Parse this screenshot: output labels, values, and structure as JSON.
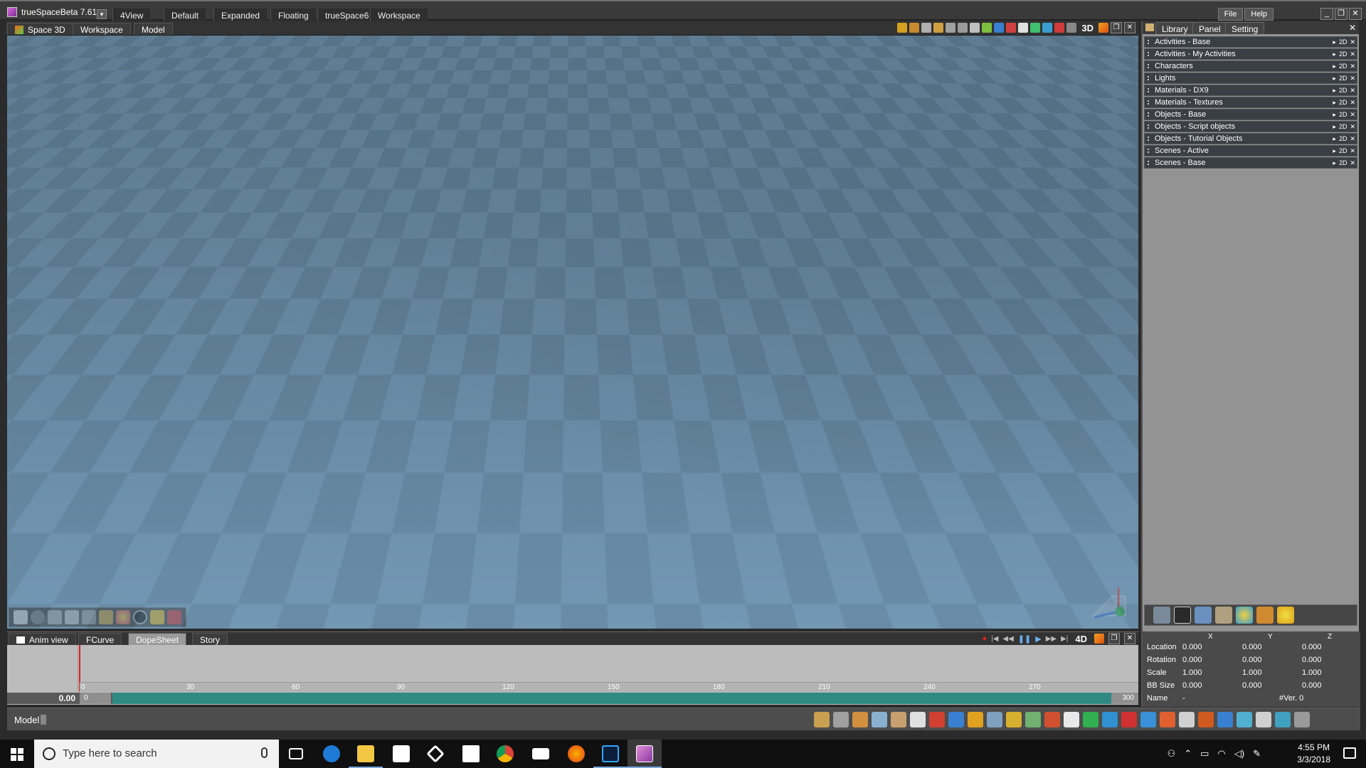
{
  "app": {
    "title": "trueSpaceBeta 7.61",
    "top_tabs": [
      "4View",
      "Default",
      "Expanded",
      "Floating",
      "trueSpace6",
      "Workspace"
    ],
    "right_menu": [
      "File",
      "Help"
    ]
  },
  "viewport": {
    "tabs": [
      "Space 3D",
      "Workspace",
      "Model"
    ],
    "mode_label": "3D"
  },
  "anim": {
    "tabs": [
      "Anim view",
      "FCurve",
      "DopeSheet",
      "Story"
    ],
    "mode_label": "4D",
    "ticks": [
      "0",
      "30",
      "60",
      "90",
      "120",
      "150",
      "180",
      "210",
      "240",
      "270"
    ],
    "current_time": "0.00",
    "range_start": "0",
    "range_end": "300"
  },
  "status": {
    "mode": "Model"
  },
  "library": {
    "tabs": [
      "Library",
      "Panel",
      "Setting"
    ],
    "items": [
      "Activities - Base",
      "Activities - My Activities",
      "Characters",
      "Lights",
      "Materials - DX9",
      "Materials - Textures",
      "Objects - Base",
      "Objects - Script objects",
      "Objects - Tutorial Objects",
      "Scenes - Active",
      "Scenes - Base"
    ],
    "row_controls": [
      "▸",
      "2D",
      "✕"
    ]
  },
  "properties": {
    "columns": [
      "X",
      "Y",
      "Z"
    ],
    "rows": [
      {
        "label": "Location",
        "x": "0.000",
        "y": "0.000",
        "z": "0.000"
      },
      {
        "label": "Rotation",
        "x": "0.000",
        "y": "0.000",
        "z": "0.000"
      },
      {
        "label": "Scale",
        "x": "1.000",
        "y": "1.000",
        "z": "1.000"
      },
      {
        "label": "BB Size",
        "x": "0.000",
        "y": "0.000",
        "z": "0.000"
      }
    ],
    "name_label": "Name",
    "name_value": "-",
    "version": "#Ver. 0"
  },
  "taskbar": {
    "search_placeholder": "Type here to search",
    "time": "4:55 PM",
    "date": "3/3/2018"
  },
  "colors": {
    "floor_light": "#6b8ea8",
    "floor_dark": "#5b7a90",
    "timeline_range": "#2f8a84",
    "playhead": "#dd2222"
  }
}
